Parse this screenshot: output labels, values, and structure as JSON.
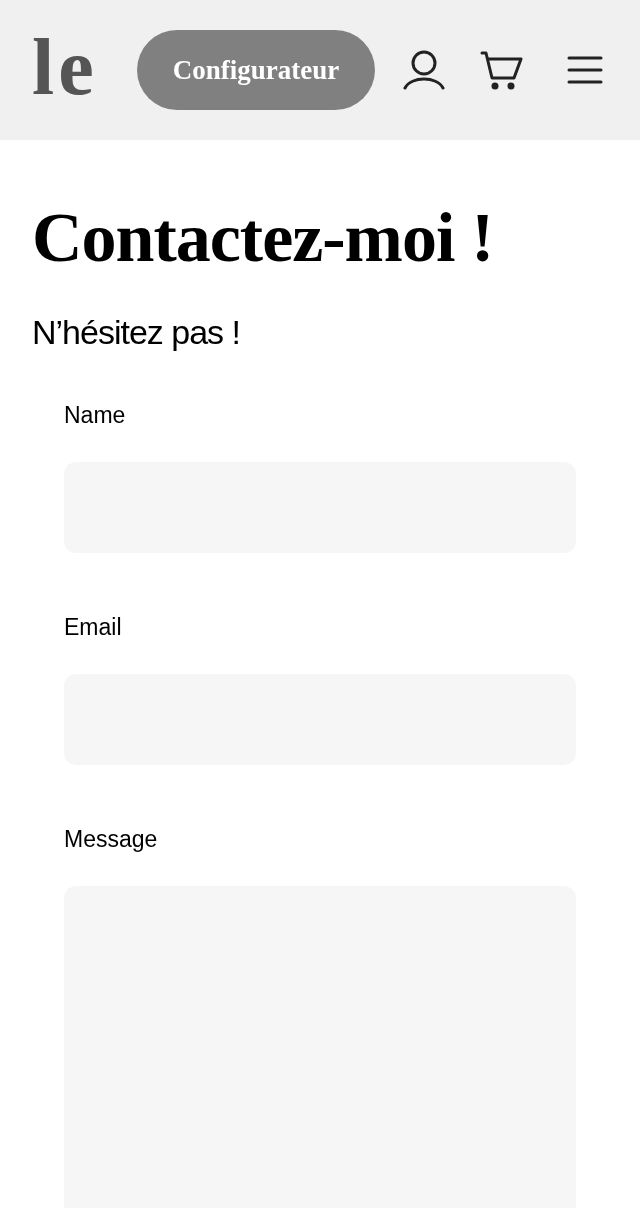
{
  "header": {
    "logo": "le",
    "configurator_button": "Configurateur"
  },
  "page": {
    "title": "Contactez-moi !",
    "subtitle": "N’hésitez pas !"
  },
  "form": {
    "fields": [
      {
        "kind": "input",
        "label": "Name"
      },
      {
        "kind": "input",
        "label": "Email"
      },
      {
        "kind": "textarea",
        "label": "Message"
      }
    ]
  }
}
